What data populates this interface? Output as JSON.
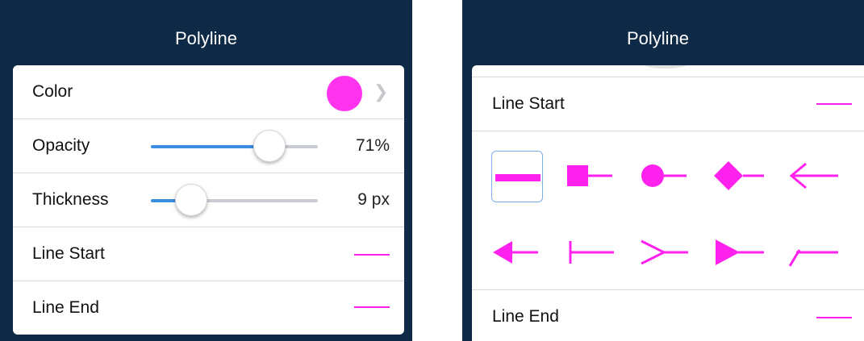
{
  "left": {
    "header": {
      "title": "Polyline"
    },
    "rows": {
      "color": {
        "label": "Color",
        "swatch": "#ff33ee"
      },
      "opacity": {
        "label": "Opacity",
        "value": "71%",
        "fraction": 0.71
      },
      "thickness": {
        "label": "Thickness",
        "value": "9 px",
        "fraction": 0.24
      },
      "line_start": {
        "label": "Line Start"
      },
      "line_end": {
        "label": "Line End"
      }
    }
  },
  "right": {
    "header": {
      "title": "Polyline"
    },
    "line_start": {
      "label": "Line Start"
    },
    "line_end": {
      "label": "Line End"
    },
    "styles": [
      "none",
      "square",
      "circle",
      "diamond",
      "open-arrow",
      "filled-arrow",
      "butt",
      "reverse-open-arrow",
      "reverse-filled-arrow",
      "slash"
    ],
    "selected_style": "none"
  },
  "colors": {
    "accent": "#ff22ee",
    "header_bg": "#0e2a47",
    "slider_fill": "#3a8ee0"
  }
}
